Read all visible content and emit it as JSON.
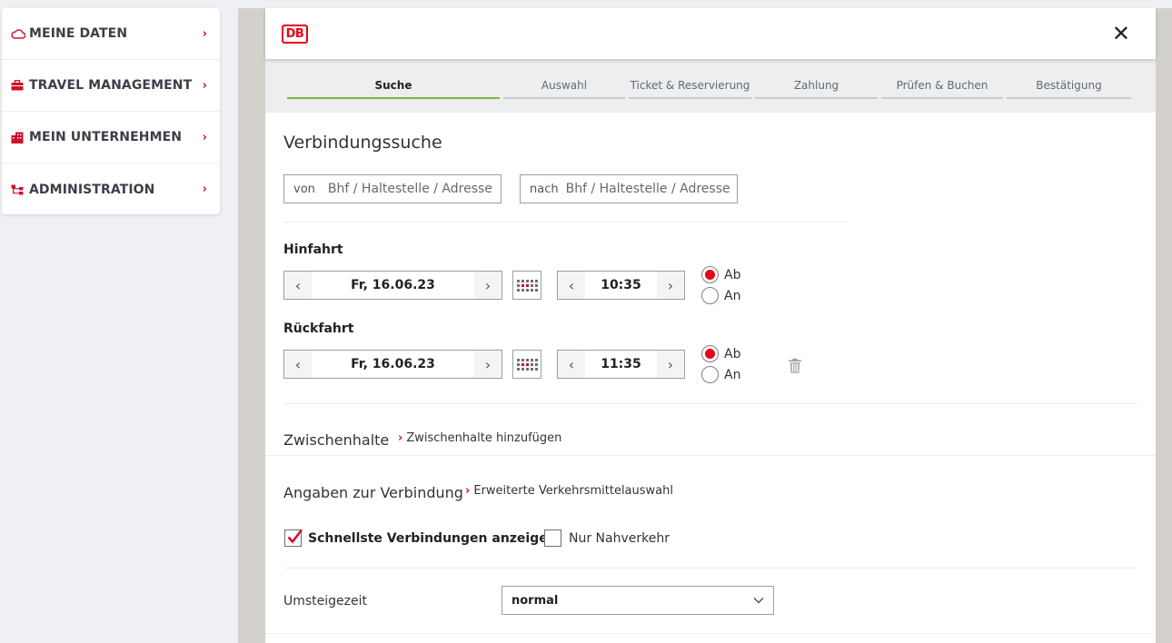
{
  "sidebar": {
    "items": [
      {
        "label": "MEINE DATEN",
        "icon": "cloud-icon"
      },
      {
        "label": "TRAVEL MANAGEMENT",
        "icon": "briefcase-icon"
      },
      {
        "label": "MEIN UNTERNEHMEN",
        "icon": "building-icon"
      },
      {
        "label": "ADMINISTRATION",
        "icon": "org-chart-icon"
      }
    ]
  },
  "modal": {
    "logo": "DB",
    "close": "✕",
    "steps": [
      {
        "label": "Suche",
        "active": true
      },
      {
        "label": "Auswahl"
      },
      {
        "label": "Ticket & Reservierung"
      },
      {
        "label": "Zahlung"
      },
      {
        "label": "Prüfen & Buchen"
      },
      {
        "label": "Bestätigung"
      }
    ]
  },
  "search": {
    "title": "Verbindungssuche",
    "from_prefix": "von",
    "from_placeholder": "Bhf / Haltestelle / Adresse",
    "to_prefix": "nach",
    "to_placeholder": "Bhf / Haltestelle / Adresse"
  },
  "outbound": {
    "label": "Hinfahrt",
    "date": "Fr, 16.06.23",
    "time": "10:35",
    "radio_ab": "Ab",
    "radio_an": "An",
    "selected": "Ab"
  },
  "return": {
    "label": "Rückfahrt",
    "date": "Fr, 16.06.23",
    "time": "11:35",
    "radio_ab": "Ab",
    "radio_an": "An",
    "selected": "Ab"
  },
  "stops": {
    "heading": "Zwischenhalte",
    "link": "Zwischenhalte hinzufügen"
  },
  "connection": {
    "heading": "Angaben zur Verbindung",
    "link": "Erweiterte Verkehrsmittelauswahl",
    "fastest_label": "Schnellste Verbindungen anzeigen",
    "fastest_checked": true,
    "local_label": "Nur Nahverkehr",
    "local_checked": false
  },
  "transfer": {
    "label": "Umsteigezeit",
    "value": "normal"
  },
  "colors": {
    "accent": "#ec0016",
    "active_step": "#7fb73a"
  }
}
